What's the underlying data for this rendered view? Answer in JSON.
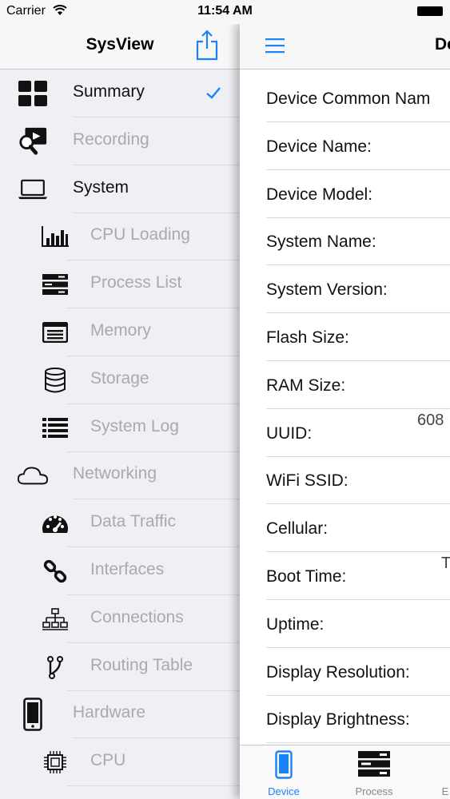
{
  "status_bar": {
    "carrier": "Carrier",
    "time": "11:54 AM"
  },
  "menu": {
    "title": "SysView",
    "items": [
      {
        "label": "Summary",
        "icon": "grid-icon",
        "level": "top",
        "state": "enabled",
        "selected": true
      },
      {
        "label": "Recording",
        "icon": "video-search-icon",
        "level": "top",
        "state": "disabled"
      },
      {
        "label": "System",
        "icon": "laptop-icon",
        "level": "top",
        "state": "enabled"
      },
      {
        "label": "CPU Loading",
        "icon": "bar-chart-icon",
        "level": "sub",
        "state": "disabled"
      },
      {
        "label": "Process List",
        "icon": "server-stack-icon",
        "level": "sub",
        "state": "disabled"
      },
      {
        "label": "Memory",
        "icon": "memory-icon",
        "level": "sub",
        "state": "disabled"
      },
      {
        "label": "Storage",
        "icon": "database-icon",
        "level": "sub",
        "state": "disabled"
      },
      {
        "label": "System Log",
        "icon": "list-icon",
        "level": "sub",
        "state": "disabled"
      },
      {
        "label": "Networking",
        "icon": "cloud-icon",
        "level": "top",
        "state": "disabled"
      },
      {
        "label": "Data Traffic",
        "icon": "speedometer-icon",
        "level": "sub",
        "state": "disabled"
      },
      {
        "label": "Interfaces",
        "icon": "link-icon",
        "level": "sub",
        "state": "disabled"
      },
      {
        "label": "Connections",
        "icon": "network-tree-icon",
        "level": "sub",
        "state": "disabled"
      },
      {
        "label": "Routing Table",
        "icon": "branch-icon",
        "level": "sub",
        "state": "disabled"
      },
      {
        "label": "Hardware",
        "icon": "phone-icon",
        "level": "top",
        "state": "disabled"
      },
      {
        "label": "CPU",
        "icon": "chip-icon",
        "level": "sub",
        "state": "disabled"
      }
    ]
  },
  "panel": {
    "title": "De",
    "rows": [
      {
        "key": "Device Common Nam",
        "value": ""
      },
      {
        "key": "Device Name:",
        "value": ""
      },
      {
        "key": "Device Model:",
        "value": ""
      },
      {
        "key": "System Name:",
        "value": ""
      },
      {
        "key": "System Version:",
        "value": ""
      },
      {
        "key": "Flash Size:",
        "value": ""
      },
      {
        "key": "RAM Size:",
        "value": ""
      },
      {
        "key": "UUID:",
        "value": "608"
      },
      {
        "key": "WiFi SSID:",
        "value": ""
      },
      {
        "key": "Cellular:",
        "value": ""
      },
      {
        "key": "Boot Time:",
        "value": "T"
      },
      {
        "key": "Uptime:",
        "value": ""
      },
      {
        "key": "Display Resolution:",
        "value": ""
      },
      {
        "key": "Display Brightness:",
        "value": ""
      }
    ]
  },
  "tabbar": {
    "tabs": [
      {
        "label": "Device",
        "icon": "phone-icon",
        "active": true
      },
      {
        "label": "Process",
        "icon": "server-stack-icon",
        "active": false
      },
      {
        "label": "E",
        "icon": "",
        "active": false
      }
    ]
  },
  "colors": {
    "accent": "#1a82fb",
    "disabled_text": "#a9a9ae",
    "menu_bg": "#efeff4"
  }
}
